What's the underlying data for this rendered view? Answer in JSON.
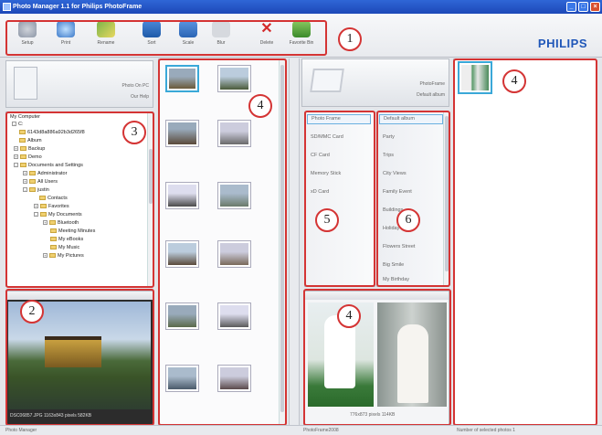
{
  "window": {
    "title": "Photo Manager 1.1 for Philips PhotoFrame"
  },
  "toolbar": {
    "items": [
      {
        "label": "Setup",
        "icon": "setup-icon"
      },
      {
        "label": "Print",
        "icon": "print-icon"
      },
      {
        "label": "Rename",
        "icon": "rename-icon"
      },
      {
        "label": "Sort",
        "icon": "sort-icon"
      },
      {
        "label": "Scale",
        "icon": "scale-icon"
      },
      {
        "label": "Blur",
        "icon": "blur-icon"
      },
      {
        "label": "Delete",
        "icon": "delete-icon"
      },
      {
        "label": "Favorite Bin",
        "icon": "favorite-bin-icon"
      }
    ],
    "brand": "PHILIPS"
  },
  "pc_panel": {
    "device": "Photo On PC",
    "action": "Our Help"
  },
  "tree": {
    "root": "My Computer",
    "items": [
      "C:",
      "6143d8a886a92b3d265f8",
      "Album",
      "Backup",
      "Demo",
      "Documents and Settings",
      "Administrator",
      "All Users",
      "justin",
      "Contacts",
      "Favorites",
      "My Documents",
      "Bluetooth",
      "Meeting Minutes",
      "My eBooks",
      "My Music",
      "My Pictures"
    ]
  },
  "preview_left": {
    "caption": "DSC06857.JPG  1163x843 pixels  582KB"
  },
  "frame_panel": {
    "name": "PhotoFrame",
    "sub": "Default album"
  },
  "sources": [
    "Photo Frame",
    "SD/MMC Card",
    "CF Card",
    "Memory Stick",
    "xD Card"
  ],
  "albums": [
    "Default album",
    "Party",
    "Trips",
    "City Views",
    "Family Event",
    "Buildings",
    "Holiday 2006",
    "Flowers Street",
    "Big Smile",
    "My Birthday"
  ],
  "preview_right": {
    "caption": "776x873 pixels  114KB"
  },
  "status": {
    "left": "Photo Manager",
    "mid": "PhotoFrame2008",
    "right": "Number of selected photos 1"
  },
  "markers": [
    "1",
    "2",
    "3",
    "4",
    "4",
    "5",
    "6"
  ],
  "colors": {
    "title_bar": "#1d48b8",
    "highlight": "#d43434",
    "brand": "#1f56b8"
  }
}
